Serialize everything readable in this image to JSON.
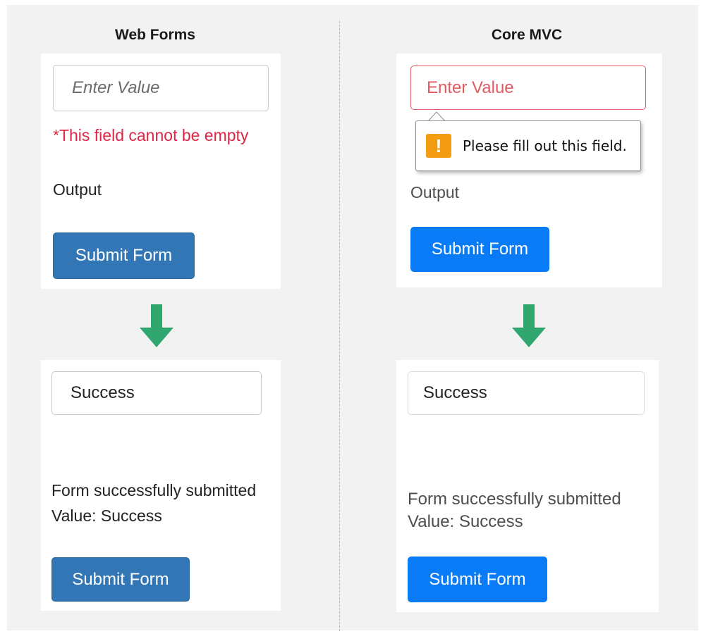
{
  "columns": {
    "left_title": "Web Forms",
    "right_title": "Core MVC"
  },
  "web_forms": {
    "before": {
      "input_placeholder": "Enter Value",
      "error_message": "*This field cannot be empty",
      "output_label": "Output",
      "submit_label": "Submit Form"
    },
    "after": {
      "input_value": "Success",
      "result_line1": "Form successfully submitted",
      "result_line2": "Value: Success",
      "submit_label": "Submit Form"
    }
  },
  "core_mvc": {
    "before": {
      "input_placeholder": "Enter Value",
      "tooltip_text": "Please fill out this field.",
      "output_label": "Output",
      "submit_label": "Submit Form"
    },
    "after": {
      "input_value": "Success",
      "result_line1": "Form successfully submitted",
      "result_line2": "Value: Success",
      "submit_label": "Submit Form"
    }
  },
  "icons": {
    "warning": "exclamation-icon",
    "arrow": "arrow-down-icon"
  },
  "colors": {
    "webforms_button": "#3376b5",
    "mvc_button": "#0a7bf7",
    "error_text": "#dc2746",
    "invalid_border": "#e15b63",
    "arrow_green": "#2fa66e",
    "warning_orange": "#f39c12"
  }
}
